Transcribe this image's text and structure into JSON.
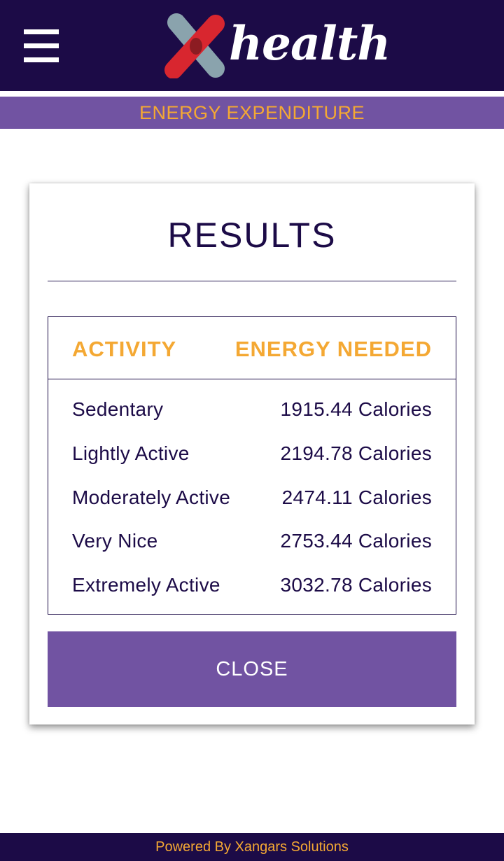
{
  "header": {
    "menu_icon": "hamburger-menu-icon",
    "logo_mark": "x-logo-icon",
    "logo_text": "health"
  },
  "subheader": {
    "title": "ENERGY EXPENDITURE"
  },
  "results": {
    "title": "RESULTS",
    "columns": {
      "activity": "ACTIVITY",
      "energy": "ENERGY NEEDED"
    },
    "rows": [
      {
        "activity": "Sedentary",
        "energy": "1915.44 Calories"
      },
      {
        "activity": "Lightly Active",
        "energy": "2194.78 Calories"
      },
      {
        "activity": "Moderately Active",
        "energy": "2474.11 Calories"
      },
      {
        "activity": "Very Nice",
        "energy": "2753.44 Calories"
      },
      {
        "activity": "Extremely Active",
        "energy": "3032.78 Calories"
      }
    ],
    "close_label": "CLOSE"
  },
  "footer": {
    "text": "Powered By Xangars Solutions"
  },
  "colors": {
    "navy": "#1c0b47",
    "purple": "#7153a2",
    "orange": "#f4a833",
    "logo_red": "#d8262f",
    "logo_gray": "#8aa3ad"
  }
}
